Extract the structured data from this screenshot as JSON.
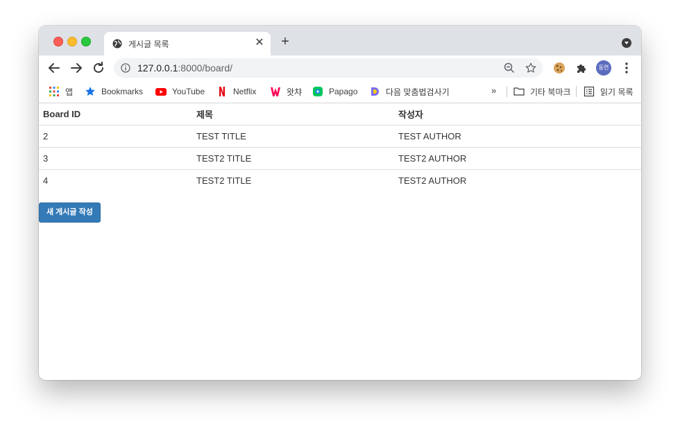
{
  "browser": {
    "tab_title": "게시글 목록",
    "url_host": "127.0.0.1",
    "url_rest": ":8000/board/",
    "profile_initials": "동연"
  },
  "bookmarks": {
    "items": [
      {
        "label": "앱",
        "icon": "apps-grid-icon"
      },
      {
        "label": "Bookmarks",
        "icon": "star-icon"
      },
      {
        "label": "YouTube",
        "icon": "youtube-icon"
      },
      {
        "label": "Netflix",
        "icon": "netflix-icon"
      },
      {
        "label": "왓챠",
        "icon": "watcha-icon"
      },
      {
        "label": "Papago",
        "icon": "papago-icon"
      },
      {
        "label": "다음 맞춤법검사기",
        "icon": "daum-icon"
      }
    ],
    "overflow": "»",
    "other_folder": "기타 북마크",
    "reading_list": "읽기 목록"
  },
  "table": {
    "headers": [
      "Board ID",
      "제목",
      "작성자"
    ],
    "rows": [
      [
        "2",
        "TEST TITLE",
        "TEST AUTHOR"
      ],
      [
        "3",
        "TEST2 TITLE",
        "TEST2 AUTHOR"
      ],
      [
        "4",
        "TEST2 TITLE",
        "TEST2 AUTHOR"
      ]
    ]
  },
  "actions": {
    "new_post_label": "새 게시글 작성"
  },
  "colors": {
    "button_primary": "#337ab7",
    "tabstrip": "#dee1e6"
  }
}
